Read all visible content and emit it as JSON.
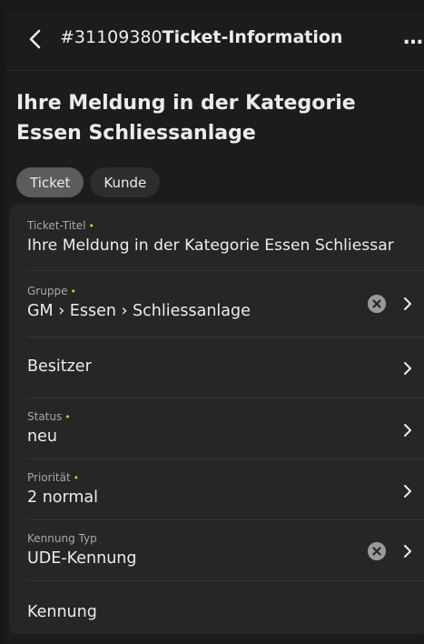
{
  "header": {
    "ticket_number": "#31109380",
    "title": "Ticket-Information",
    "more_label": "…"
  },
  "page_title": "Ihre Meldung in der Kategorie Essen Schliessanlage",
  "tabs": [
    {
      "label": "Ticket",
      "active": true
    },
    {
      "label": "Kunde",
      "active": false
    }
  ],
  "fields": {
    "ticket_title": {
      "label": "Ticket-Titel",
      "required_mark": "•",
      "value": "Ihre Meldung in der Kategorie Essen Schliessar"
    },
    "group": {
      "label": "Gruppe",
      "required_mark": "•",
      "value": "GM › Essen › Schliessanlage"
    },
    "owner": {
      "label": "Besitzer"
    },
    "status": {
      "label": "Status",
      "required_mark": "•",
      "value": "neu"
    },
    "priority": {
      "label": "Priorität",
      "required_mark": "•",
      "value": "2 normal"
    },
    "id_type": {
      "label": "Kennung Typ",
      "value": "UDE-Kennung"
    },
    "id": {
      "label": "Kennung"
    }
  },
  "colors": {
    "background": "#1c1c1c",
    "card": "#262626",
    "required_mark": "#e3c03e",
    "active_tab": "#5c5c5c"
  }
}
